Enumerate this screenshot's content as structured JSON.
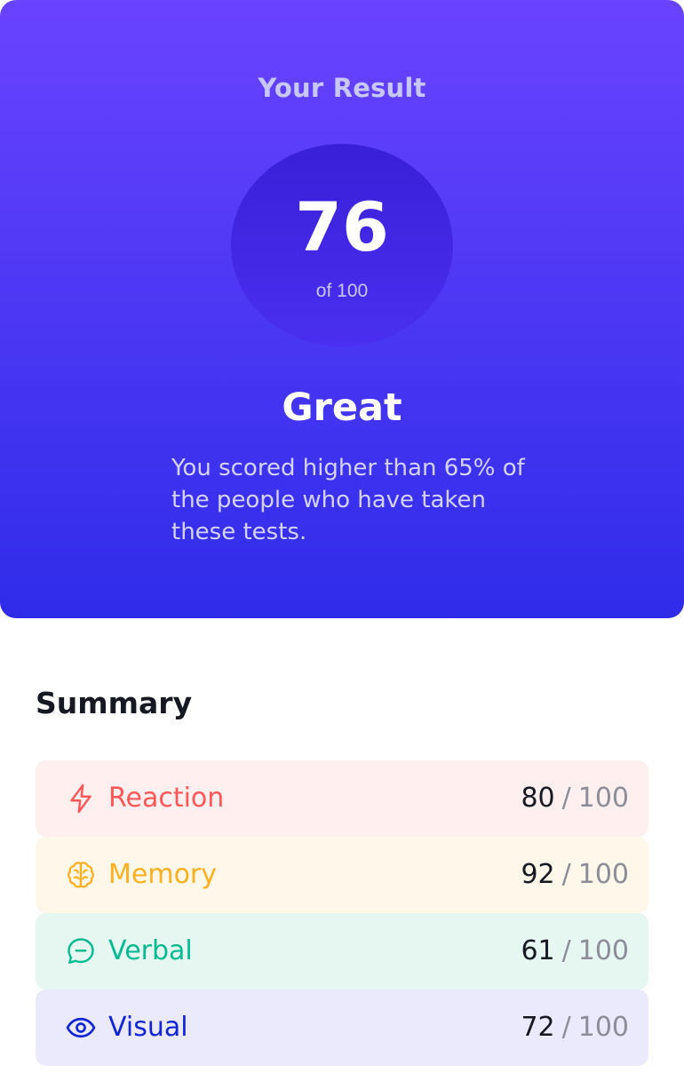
{
  "result": {
    "title": "Your Result",
    "score": "76",
    "score_of": "of 100",
    "rating": "Great",
    "description": "You scored higher than 65% of the people who have taken these tests."
  },
  "summary": {
    "title": "Summary",
    "items": [
      {
        "label": "Reaction",
        "score": "80",
        "separator": "/",
        "max": "100",
        "icon": "lightning-icon",
        "color": "#ff5757"
      },
      {
        "label": "Memory",
        "score": "92",
        "separator": "/",
        "max": "100",
        "icon": "brain-icon",
        "color": "#ffb01f"
      },
      {
        "label": "Verbal",
        "score": "61",
        "separator": "/",
        "max": "100",
        "icon": "chat-bubble-icon",
        "color": "#00bb8f"
      },
      {
        "label": "Visual",
        "score": "72",
        "separator": "/",
        "max": "100",
        "icon": "eye-icon",
        "color": "#1125d6"
      }
    ]
  },
  "colors": {
    "gradient_top": "#6943ff",
    "gradient_bottom": "#2f2ce9"
  }
}
